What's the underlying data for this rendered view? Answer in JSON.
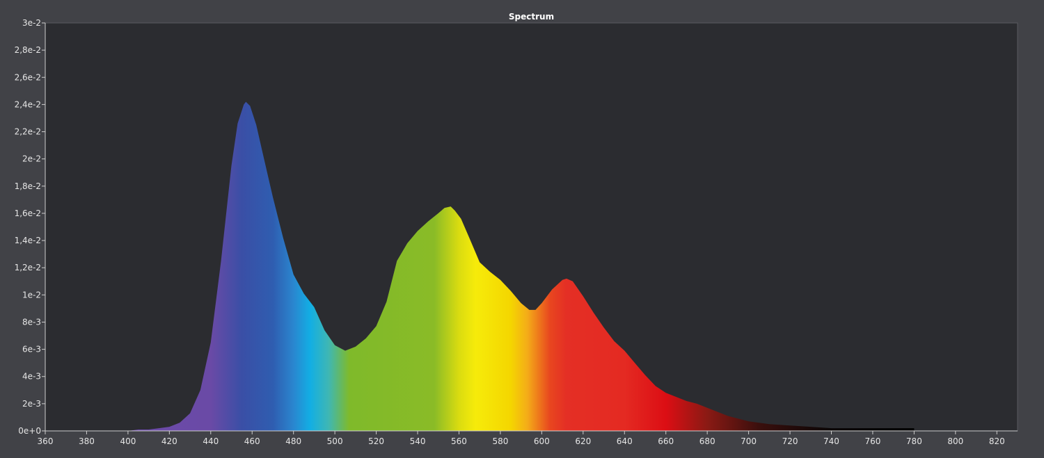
{
  "chart_data": {
    "type": "area",
    "title": "Spectrum",
    "xlabel": "",
    "ylabel": "",
    "xlim": [
      360,
      830
    ],
    "ylim": [
      0,
      0.03
    ],
    "grid": false,
    "legend": "none",
    "x_ticks": [
      {
        "value": 360,
        "label": "360"
      },
      {
        "value": 380,
        "label": "380"
      },
      {
        "value": 400,
        "label": "400"
      },
      {
        "value": 420,
        "label": "420"
      },
      {
        "value": 440,
        "label": "440"
      },
      {
        "value": 460,
        "label": "460"
      },
      {
        "value": 480,
        "label": "480"
      },
      {
        "value": 500,
        "label": "500"
      },
      {
        "value": 520,
        "label": "520"
      },
      {
        "value": 540,
        "label": "540"
      },
      {
        "value": 560,
        "label": "560"
      },
      {
        "value": 580,
        "label": "580"
      },
      {
        "value": 600,
        "label": "600"
      },
      {
        "value": 620,
        "label": "620"
      },
      {
        "value": 640,
        "label": "640"
      },
      {
        "value": 660,
        "label": "660"
      },
      {
        "value": 680,
        "label": "680"
      },
      {
        "value": 700,
        "label": "700"
      },
      {
        "value": 720,
        "label": "720"
      },
      {
        "value": 740,
        "label": "740"
      },
      {
        "value": 760,
        "label": "760"
      },
      {
        "value": 780,
        "label": "780"
      },
      {
        "value": 800,
        "label": "800"
      },
      {
        "value": 820,
        "label": "820"
      }
    ],
    "y_ticks": [
      {
        "value": 0,
        "label": "0e+0"
      },
      {
        "value": 0.002,
        "label": "2e-3"
      },
      {
        "value": 0.004,
        "label": "4e-3"
      },
      {
        "value": 0.006,
        "label": "6e-3"
      },
      {
        "value": 0.008,
        "label": "8e-3"
      },
      {
        "value": 0.01,
        "label": "1e-2"
      },
      {
        "value": 0.012,
        "label": "1,2e-2"
      },
      {
        "value": 0.014,
        "label": "1,4e-2"
      },
      {
        "value": 0.016,
        "label": "1,6e-2"
      },
      {
        "value": 0.018,
        "label": "1,8e-2"
      },
      {
        "value": 0.02,
        "label": "2e-2"
      },
      {
        "value": 0.022,
        "label": "2,2e-2"
      },
      {
        "value": 0.024,
        "label": "2,4e-2"
      },
      {
        "value": 0.026,
        "label": "2,6e-2"
      },
      {
        "value": 0.028,
        "label": "2,8e-2"
      },
      {
        "value": 0.03,
        "label": "3e-2"
      }
    ],
    "series": [
      {
        "x": [
          400,
          405,
          410,
          415,
          420,
          425,
          430,
          435,
          440,
          445,
          450,
          453,
          456,
          457,
          459,
          462,
          465,
          470,
          475,
          480,
          485,
          490,
          495,
          500,
          505,
          510,
          515,
          520,
          525,
          530,
          535,
          540,
          545,
          550,
          553,
          556,
          558,
          561,
          565,
          570,
          575,
          580,
          585,
          590,
          594,
          597,
          600,
          605,
          610,
          612,
          615,
          620,
          625,
          630,
          635,
          640,
          645,
          650,
          655,
          660,
          665,
          670,
          675,
          680,
          685,
          690,
          695,
          700,
          710,
          720,
          730,
          740,
          750,
          760,
          770,
          780
        ],
        "y": [
          0.0,
          0.0001,
          0.0001,
          0.0002,
          0.0003,
          0.0006,
          0.0013,
          0.003,
          0.0065,
          0.0125,
          0.0195,
          0.0226,
          0.024,
          0.0242,
          0.0239,
          0.0225,
          0.0205,
          0.0172,
          0.0142,
          0.0115,
          0.0101,
          0.0091,
          0.0074,
          0.0063,
          0.0059,
          0.0062,
          0.0068,
          0.0077,
          0.0095,
          0.0125,
          0.0138,
          0.0147,
          0.0154,
          0.016,
          0.0164,
          0.0165,
          0.0162,
          0.0156,
          0.0142,
          0.0124,
          0.0117,
          0.0111,
          0.0103,
          0.0094,
          0.0089,
          0.0089,
          0.0094,
          0.0104,
          0.0111,
          0.0112,
          0.011,
          0.0099,
          0.0087,
          0.0076,
          0.0066,
          0.0059,
          0.005,
          0.0041,
          0.0033,
          0.0028,
          0.0025,
          0.0022,
          0.002,
          0.0017,
          0.0014,
          0.0011,
          0.0009,
          0.0007,
          0.0005,
          0.0004,
          0.0003,
          0.0002,
          0.0002,
          0.0002,
          0.0002,
          0.0002
        ]
      }
    ]
  },
  "colors": {
    "window_background": "#414247",
    "plot_background": "#2b2c30",
    "axis_color": "#cfcfcf",
    "text_color": "#e6e6e6",
    "spectrum_stops": [
      {
        "nm": 420,
        "color": "#6b4aa8"
      },
      {
        "nm": 440,
        "color": "#6a4aa6"
      },
      {
        "nm": 455,
        "color": "#3a4fa6"
      },
      {
        "nm": 470,
        "color": "#2f5db0"
      },
      {
        "nm": 480,
        "color": "#2a86cf"
      },
      {
        "nm": 488,
        "color": "#12aee4"
      },
      {
        "nm": 497,
        "color": "#3fb7b3"
      },
      {
        "nm": 507,
        "color": "#7fba2a"
      },
      {
        "nm": 548,
        "color": "#8abb27"
      },
      {
        "nm": 560,
        "color": "#dadc10"
      },
      {
        "nm": 568,
        "color": "#f6eb0a"
      },
      {
        "nm": 585,
        "color": "#f4d600"
      },
      {
        "nm": 593,
        "color": "#f4ac18"
      },
      {
        "nm": 604,
        "color": "#e8461f"
      },
      {
        "nm": 612,
        "color": "#e42f25"
      },
      {
        "nm": 640,
        "color": "#e42a22"
      },
      {
        "nm": 660,
        "color": "#dc0e14"
      },
      {
        "nm": 680,
        "color": "#8a1a14"
      },
      {
        "nm": 705,
        "color": "#3a0f0d"
      },
      {
        "nm": 740,
        "color": "#0a0606"
      },
      {
        "nm": 780,
        "color": "#000000"
      }
    ]
  }
}
